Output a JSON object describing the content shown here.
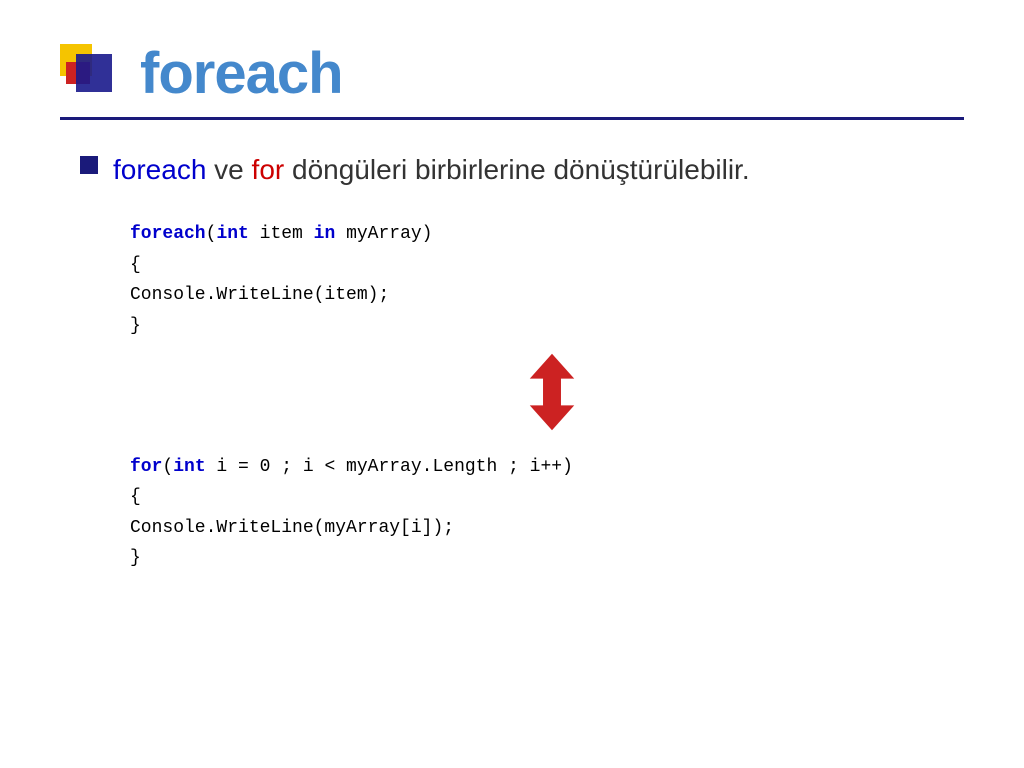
{
  "header": {
    "title": "foreach"
  },
  "bullet": {
    "text_part1": "foreach",
    "text_part2": " ve ",
    "text_part3": "for",
    "text_part4": " döngüleri birbirlerine dönüştürülebilir."
  },
  "code1": {
    "line1": "foreach(int item in myArray)",
    "line2": "{",
    "line3": "    Console.WriteLine(item);",
    "line4": "}"
  },
  "code2": {
    "line1": "for(int i = 0 ; i < myArray.Length ; i++)",
    "line2": "{",
    "line3": "    Console.WriteLine(myArray[i]);",
    "line4": "}"
  },
  "colors": {
    "title": "#4488cc",
    "bullet_blue": "#0000cc",
    "bullet_red": "#cc0000",
    "code_blue": "#0000cc",
    "arrow_red": "#cc0000",
    "logo_yellow": "#f5c400",
    "logo_red": "#cc2222",
    "logo_blue": "#1a1a8c",
    "border": "#1a1a7a"
  }
}
